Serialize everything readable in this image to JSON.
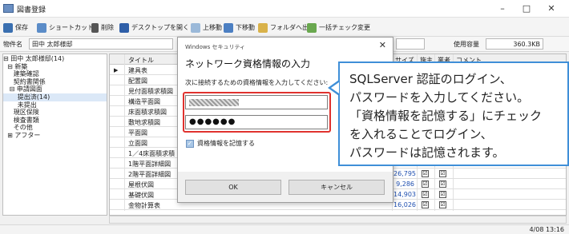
{
  "window": {
    "title": "図書登録",
    "minimize": "–",
    "maximize": "□",
    "close": "✕"
  },
  "toolbar": {
    "save": "保存",
    "shortcut": "ショートカット",
    "delete": "削除",
    "open_desktop": "デスクトップを開く",
    "move_up": "上移動",
    "move_down": "下移動",
    "export_folder": "フォルダへ出力",
    "bulk_check": "一括チェック変更"
  },
  "infobar": {
    "property_label": "物件名",
    "property_value": "田中 太郎様邸",
    "usage_label": "使用容量",
    "usage_value": "360.3KB"
  },
  "tree": {
    "items": [
      "⊟ 田中 太郎様邸(14)",
      "  ⊟ 新築",
      "     建築確認",
      "     契約書関係",
      "   ⊟ 申請図面",
      "       提出済(14)",
      "       未提出",
      "     現区保険",
      "     検査書類",
      "     その他",
      "  ⊞ アフター"
    ]
  },
  "grid": {
    "headers": {
      "title": "タイトル",
      "size": "サイズ",
      "applicant": "施主",
      "contractor": "業者",
      "comment": "コメント"
    },
    "rows": [
      {
        "title": "建具表",
        "size": "",
        "applicant": "",
        "contractor": ""
      },
      {
        "title": "配置図",
        "size": "",
        "applicant": "",
        "contractor": ""
      },
      {
        "title": "見付面積求積図",
        "size": "",
        "applicant": "",
        "contractor": ""
      },
      {
        "title": "構造平面図",
        "size": "",
        "applicant": "",
        "contractor": ""
      },
      {
        "title": "床面積求積図",
        "size": "",
        "applicant": "",
        "contractor": ""
      },
      {
        "title": "敷地求積図",
        "size": "",
        "applicant": "",
        "contractor": ""
      },
      {
        "title": "平面図",
        "size": "",
        "applicant": "",
        "contractor": ""
      },
      {
        "title": "立面図",
        "size": "",
        "applicant": "",
        "contractor": ""
      },
      {
        "title": "1／4床面積求積",
        "size": "",
        "applicant": "",
        "contractor": ""
      },
      {
        "title": "1階平面詳細図",
        "size": "",
        "applicant": "",
        "contractor": ""
      },
      {
        "title": "2階平面詳細図",
        "size": "26,795",
        "applicant": "☑",
        "contractor": "☑"
      },
      {
        "title": "屋根伏図",
        "size": "9,286",
        "applicant": "☑",
        "contractor": "☑"
      },
      {
        "title": "基礎伏図",
        "size": "14,903",
        "applicant": "☑",
        "contractor": "☑"
      },
      {
        "title": "金物計算表",
        "size": "16,026",
        "applicant": "☑",
        "contractor": "☑"
      }
    ]
  },
  "dialog": {
    "system_label": "Windows セキュリティ",
    "title": "ネットワーク資格情報の入力",
    "description": "次に接続するための資格情報を入力してください:",
    "password_mask": "●●●●●●",
    "remember_label": "資格情報を記憶する",
    "ok": "OK",
    "cancel": "キャンセル",
    "close": "✕"
  },
  "callout": {
    "lines": [
      "SQLServer 認証のログイン、",
      "パスワードを入力してください。",
      "「資格情報を記憶する」にチェック",
      "を入れることでログイン、",
      "パスワードは記憶されます。"
    ]
  },
  "status": {
    "time": "4/08 13:16"
  },
  "colors": {
    "highlight_red": "#e0322e",
    "callout_blue": "#3f8fd8",
    "size_text": "#1f4fb0"
  },
  "icons": [
    "app-icon",
    "save-icon",
    "shortcut-icon",
    "trash-icon",
    "desktop-icon",
    "arrow-up-icon",
    "arrow-down-icon",
    "folder-export-icon",
    "bulk-check-icon"
  ]
}
